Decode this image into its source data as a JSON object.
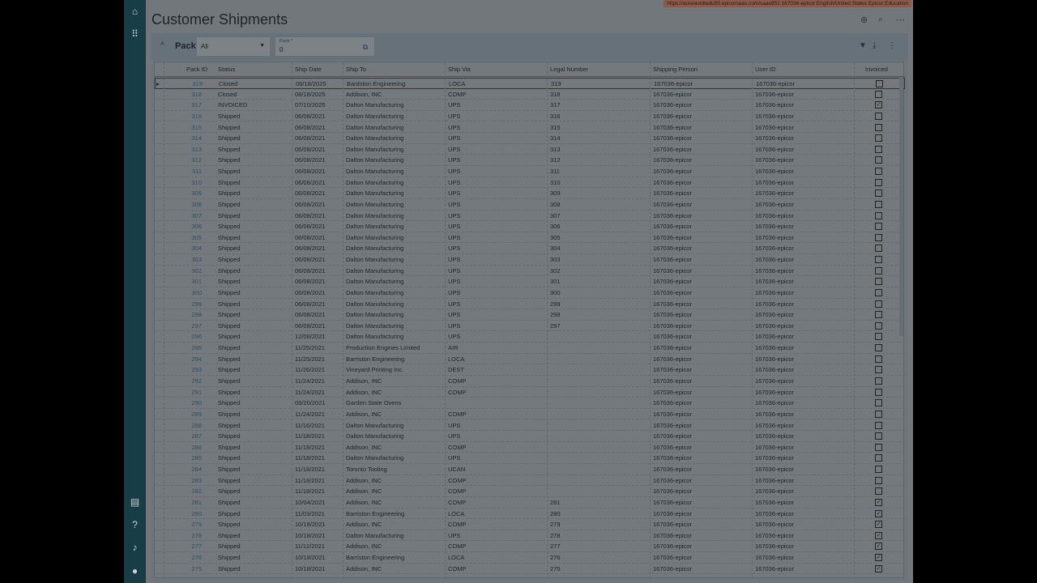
{
  "info_bar": "https://auseastdtedu00.epicorsaas.com/saas951   167036-epicor   English/United States   Epicor Education",
  "title": "Customer Shipments",
  "sidebar": {
    "icons": [
      "home-icon",
      "apps-grid-icon",
      "chat-icon",
      "help-icon",
      "bell-icon",
      "user-icon"
    ]
  },
  "toolbar": {
    "pack_label": "Pack",
    "filter_value": "All",
    "pack_field_label": "Pack *",
    "pack_field_value": "0"
  },
  "columns": [
    "Pack ID",
    "Status",
    "Ship Date",
    "Ship To",
    "Ship Via",
    "Legal Number",
    "Shipping Person",
    "User ID",
    "Invoiced"
  ],
  "shipping_person": "167036-epicor",
  "user_id": "167036-epicor",
  "rows": [
    [
      "319",
      "Closed",
      "08/18/2025",
      "Bardston Engineering",
      "LOCA",
      "319",
      false
    ],
    [
      "318",
      "Closed",
      "08/18/2025",
      "Addison, INC",
      "COMP",
      "318",
      false
    ],
    [
      "317",
      "INVOICED",
      "07/10/2025",
      "Dalton Manufacturing",
      "UPS",
      "317",
      true
    ],
    [
      "316",
      "Shipped",
      "06/08/2021",
      "Dalton Manufacturing",
      "UPS",
      "316",
      false
    ],
    [
      "315",
      "Shipped",
      "06/08/2021",
      "Dalton Manufacturing",
      "UPS",
      "315",
      false
    ],
    [
      "314",
      "Shipped",
      "06/08/2021",
      "Dalton Manufacturing",
      "UPS",
      "314",
      false
    ],
    [
      "313",
      "Shipped",
      "06/08/2021",
      "Dalton Manufacturing",
      "UPS",
      "313",
      false
    ],
    [
      "312",
      "Shipped",
      "06/08/2021",
      "Dalton Manufacturing",
      "UPS",
      "312",
      false
    ],
    [
      "311",
      "Shipped",
      "06/08/2021",
      "Dalton Manufacturing",
      "UPS",
      "311",
      false
    ],
    [
      "310",
      "Shipped",
      "06/08/2021",
      "Dalton Manufacturing",
      "UPS",
      "310",
      false
    ],
    [
      "309",
      "Shipped",
      "06/08/2021",
      "Dalton Manufacturing",
      "UPS",
      "309",
      false
    ],
    [
      "308",
      "Shipped",
      "06/08/2021",
      "Dalton Manufacturing",
      "UPS",
      "308",
      false
    ],
    [
      "307",
      "Shipped",
      "06/08/2021",
      "Dalton Manufacturing",
      "UPS",
      "307",
      false
    ],
    [
      "306",
      "Shipped",
      "06/08/2021",
      "Dalton Manufacturing",
      "UPS",
      "306",
      false
    ],
    [
      "305",
      "Shipped",
      "06/08/2021",
      "Dalton Manufacturing",
      "UPS",
      "305",
      false
    ],
    [
      "304",
      "Shipped",
      "06/08/2021",
      "Dalton Manufacturing",
      "UPS",
      "304",
      false
    ],
    [
      "303",
      "Shipped",
      "06/08/2021",
      "Dalton Manufacturing",
      "UPS",
      "303",
      false
    ],
    [
      "302",
      "Shipped",
      "06/08/2021",
      "Dalton Manufacturing",
      "UPS",
      "302",
      false
    ],
    [
      "301",
      "Shipped",
      "06/08/2021",
      "Dalton Manufacturing",
      "UPS",
      "301",
      false
    ],
    [
      "300",
      "Shipped",
      "06/08/2021",
      "Dalton Manufacturing",
      "UPS",
      "300",
      false
    ],
    [
      "299",
      "Shipped",
      "06/08/2021",
      "Dalton Manufacturing",
      "UPS",
      "299",
      false
    ],
    [
      "298",
      "Shipped",
      "06/08/2021",
      "Dalton Manufacturing",
      "UPS",
      "298",
      false
    ],
    [
      "297",
      "Shipped",
      "06/08/2021",
      "Dalton Manufacturing",
      "UPS",
      "297",
      false
    ],
    [
      "296",
      "Shipped",
      "12/08/2021",
      "Dalton Manufacturing",
      "UPS",
      "",
      false
    ],
    [
      "295",
      "Shipped",
      "11/25/2021",
      "Production Engines Limited",
      "AIR",
      "",
      false
    ],
    [
      "294",
      "Shipped",
      "11/25/2021",
      "Barriston Engineering",
      "LOCA",
      "",
      false
    ],
    [
      "293",
      "Shipped",
      "11/26/2021",
      "Vineyard Printing Inc.",
      "DEST",
      "",
      false
    ],
    [
      "292",
      "Shipped",
      "11/24/2021",
      "Addison, INC",
      "COMP",
      "",
      false
    ],
    [
      "291",
      "Shipped",
      "11/24/2021",
      "Addison, INC",
      "COMP",
      "",
      false
    ],
    [
      "290",
      "Shipped",
      "09/20/2021",
      "Garden State Ovens",
      "",
      "",
      false
    ],
    [
      "289",
      "Shipped",
      "11/24/2021",
      "Addison, INC",
      "COMP",
      "",
      false
    ],
    [
      "288",
      "Shipped",
      "11/16/2021",
      "Dalton Manufacturing",
      "UPS",
      "",
      false
    ],
    [
      "287",
      "Shipped",
      "11/18/2021",
      "Dalton Manufacturing",
      "UPS",
      "",
      false
    ],
    [
      "286",
      "Shipped",
      "11/18/2021",
      "Addison, INC",
      "COMP",
      "",
      false
    ],
    [
      "285",
      "Shipped",
      "11/18/2021",
      "Dalton Manufacturing",
      "UPS",
      "",
      false
    ],
    [
      "284",
      "Shipped",
      "11/18/2021",
      "Toronto Tooling",
      "UCAN",
      "",
      false
    ],
    [
      "283",
      "Shipped",
      "11/18/2021",
      "Addison, INC",
      "COMP",
      "",
      false
    ],
    [
      "282",
      "Shipped",
      "11/18/2021",
      "Addison, INC",
      "COMP",
      "",
      false
    ],
    [
      "281",
      "Shipped",
      "10/04/2021",
      "Addison, INC",
      "COMP",
      "281",
      true
    ],
    [
      "280",
      "Shipped",
      "11/03/2021",
      "Barriston Engineering",
      "LOCA",
      "280",
      true
    ],
    [
      "279",
      "Shipped",
      "10/18/2021",
      "Addison, INC",
      "COMP",
      "279",
      true
    ],
    [
      "278",
      "Shipped",
      "10/18/2021",
      "Dalton Manufacturing",
      "UPS",
      "278",
      true
    ],
    [
      "277",
      "Shipped",
      "11/12/2021",
      "Addison, INC",
      "COMP",
      "277",
      true
    ],
    [
      "276",
      "Shipped",
      "10/18/2021",
      "Barriston Engineering",
      "LOCA",
      "276",
      true
    ],
    [
      "275",
      "Shipped",
      "10/18/2021",
      "Addison, INC",
      "COMP",
      "275",
      true
    ]
  ]
}
